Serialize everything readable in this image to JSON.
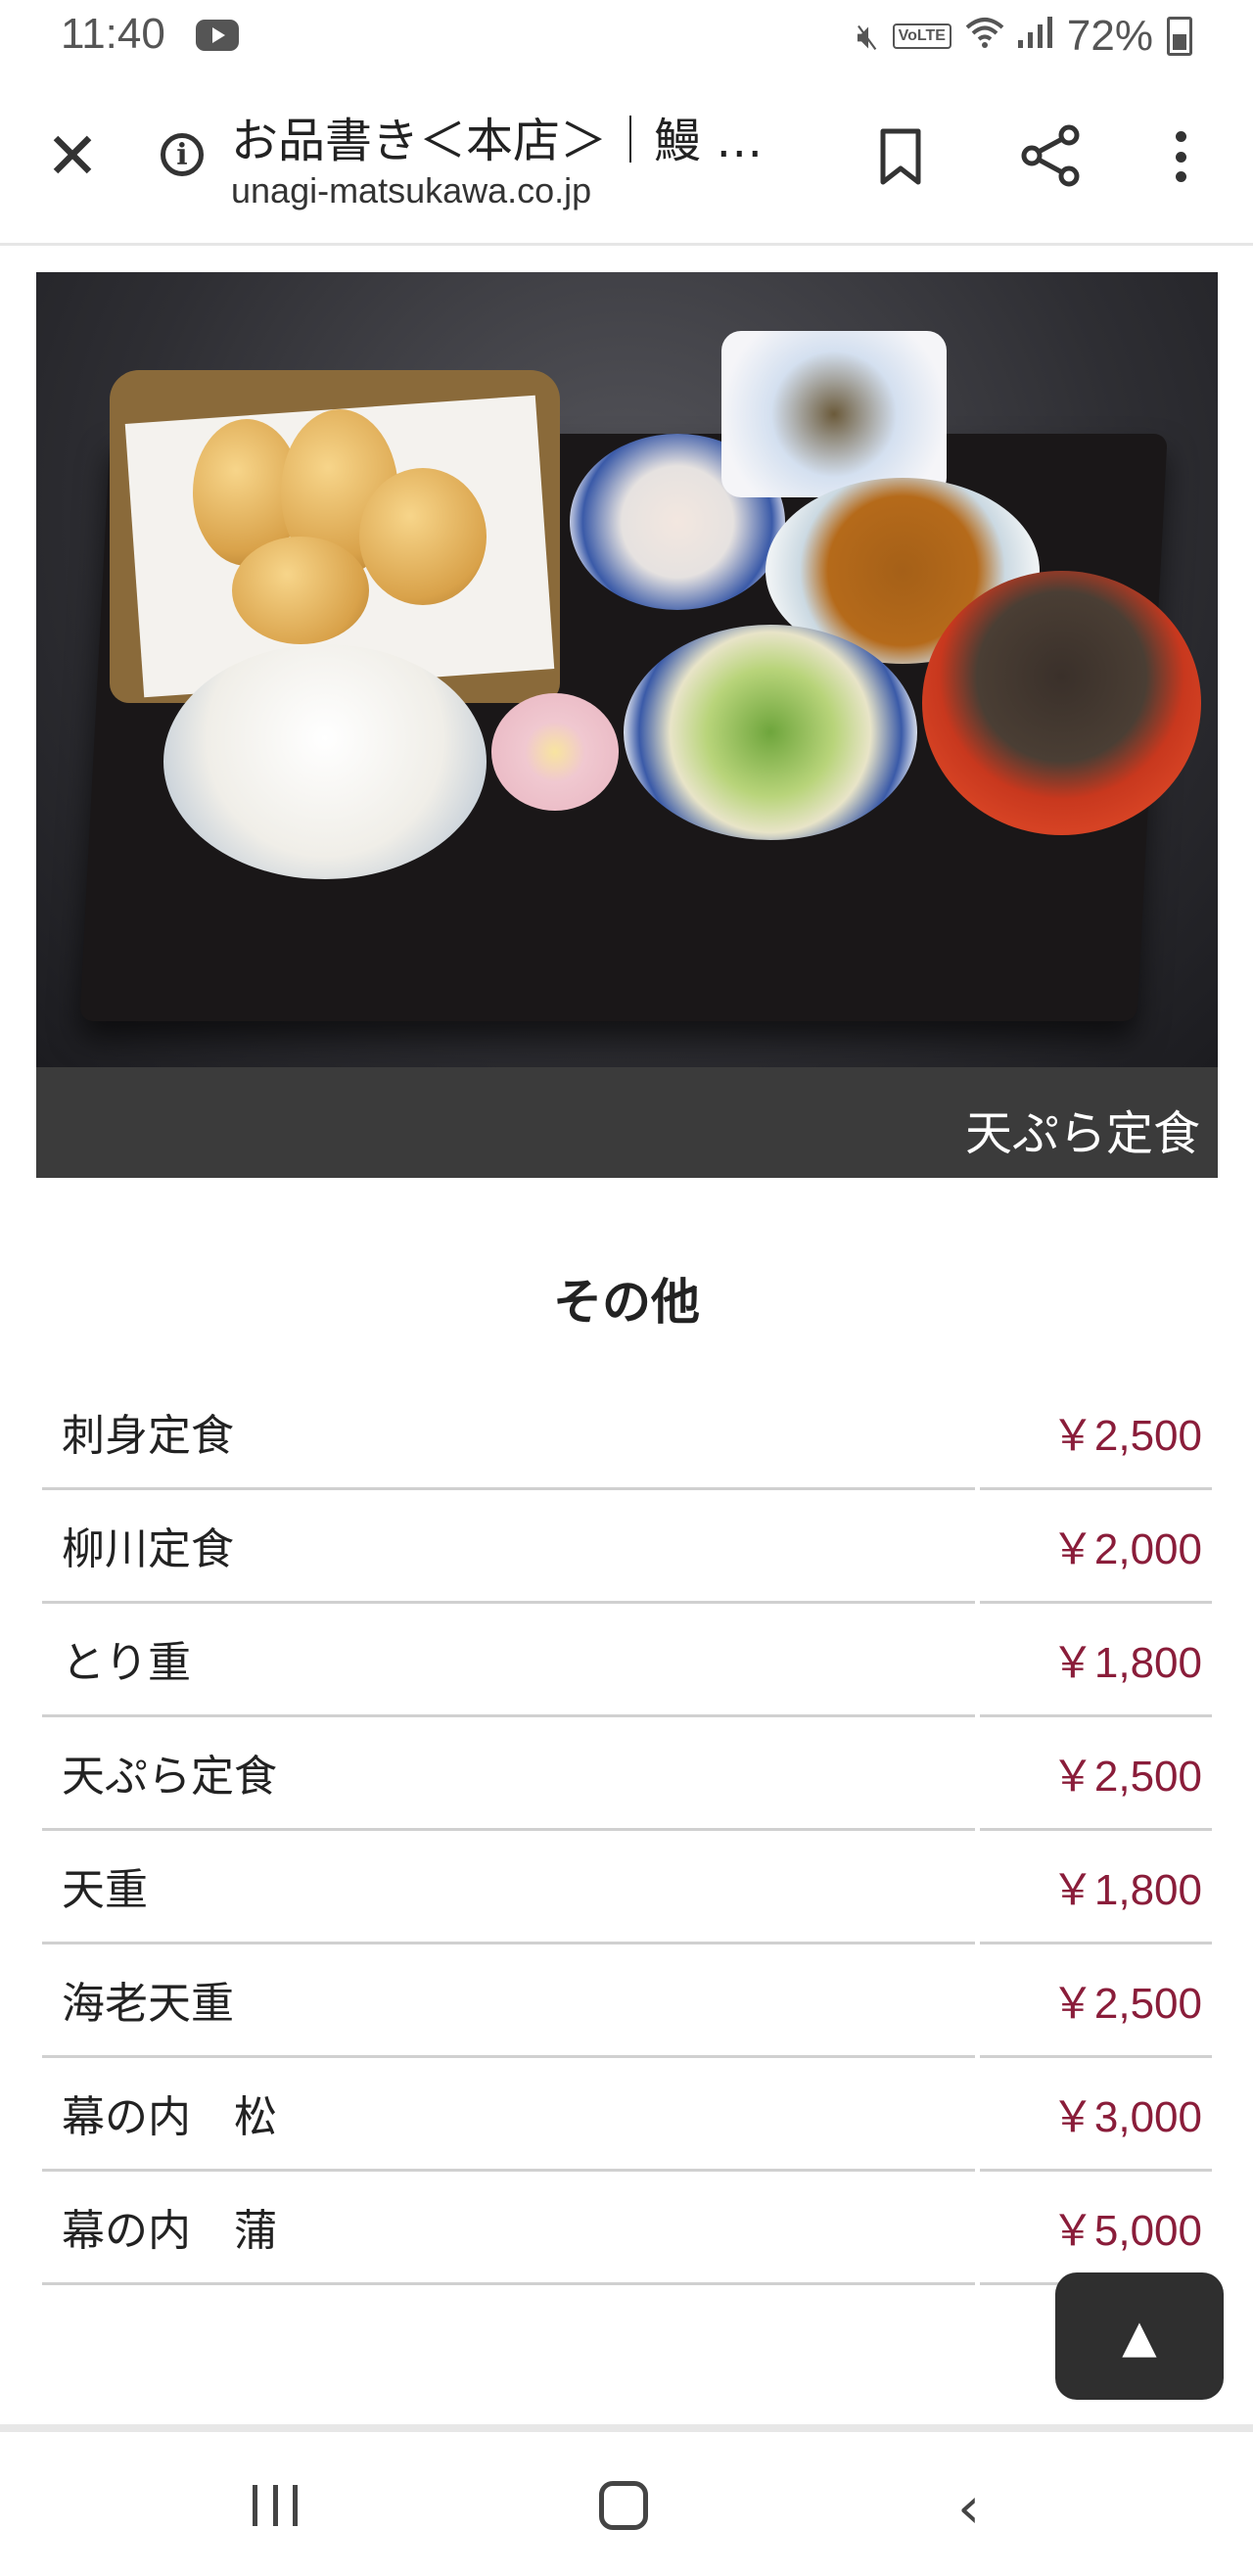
{
  "status_bar": {
    "time": "11:40",
    "battery": "72%",
    "volte": "VoLTE",
    "icons": [
      "youtube-icon",
      "mute-icon",
      "volte-icon",
      "wifi-icon",
      "signal-icon",
      "battery-icon"
    ]
  },
  "browser": {
    "title": "お品書き＜本店＞｜鰻 …",
    "url": "unagi-matsukawa.co.jp",
    "icons": [
      "close-icon",
      "info-icon",
      "bookmark-icon",
      "share-icon",
      "more-vert-icon"
    ]
  },
  "hero": {
    "caption": "天ぷら定食"
  },
  "menu": {
    "section_title": "その他",
    "items": [
      {
        "name": "刺身定食",
        "price": "￥2,500"
      },
      {
        "name": "柳川定食",
        "price": "￥2,000"
      },
      {
        "name": "とり重",
        "price": "￥1,800"
      },
      {
        "name": "天ぷら定食",
        "price": "￥2,500"
      },
      {
        "name": "天重",
        "price": "￥1,800"
      },
      {
        "name": "海老天重",
        "price": "￥2,500"
      },
      {
        "name": "幕の内　松",
        "price": "￥3,000"
      },
      {
        "name": "幕の内　蒲",
        "price": "￥5,000"
      }
    ]
  },
  "scroll_top": {
    "label": "▲"
  },
  "colors": {
    "price": "#8a1d3a",
    "caption_bg": "#3b3b3b",
    "scroll_button_bg": "#2f2f2f"
  },
  "nav_bar": {
    "icons": [
      "recents-icon",
      "home-icon",
      "back-icon"
    ]
  }
}
